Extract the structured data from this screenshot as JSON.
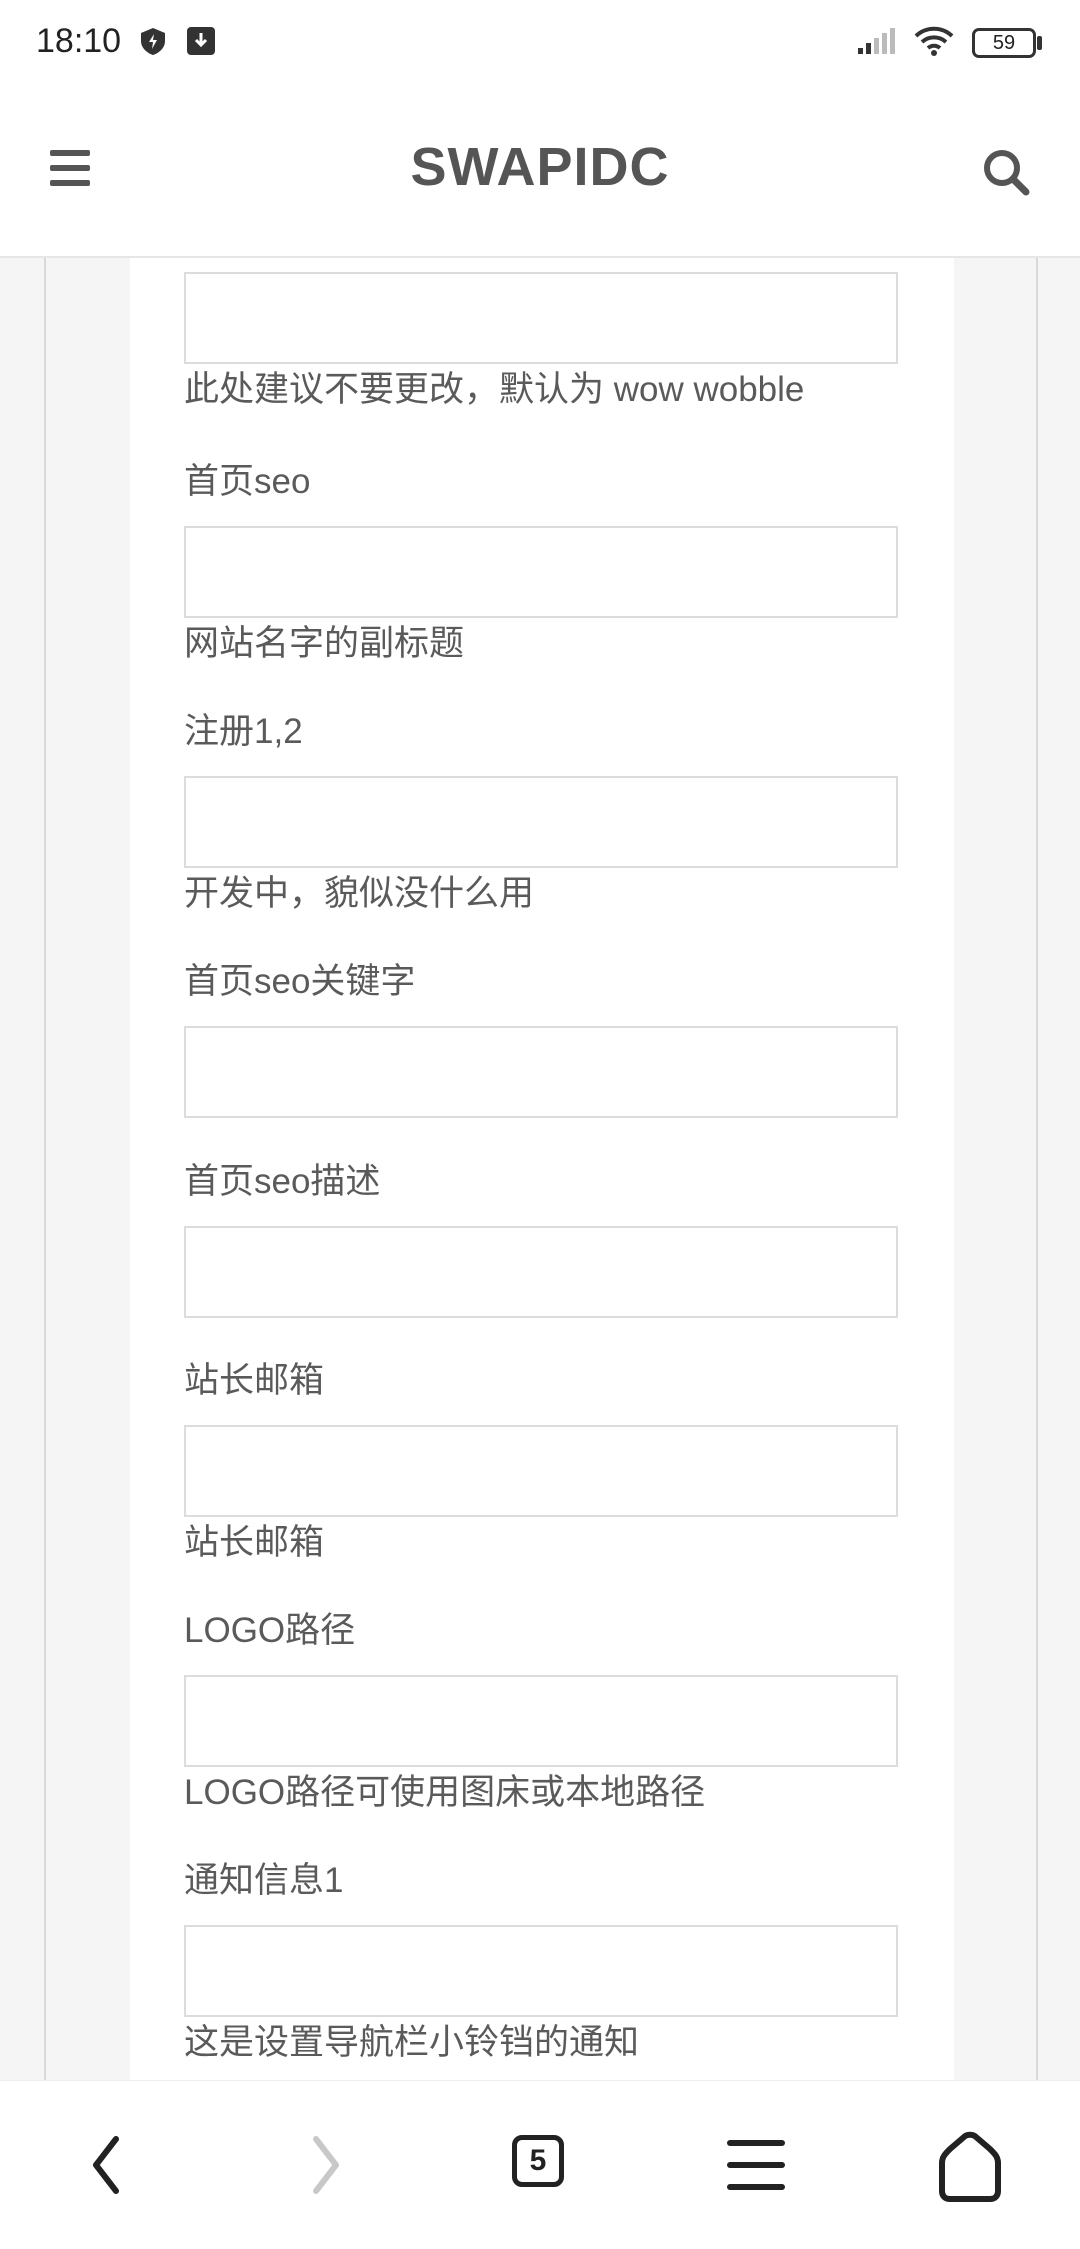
{
  "status_bar": {
    "time": "18:10",
    "battery": "59",
    "icons": [
      "shield-icon",
      "download-icon",
      "signal-icon",
      "wifi-icon",
      "battery-icon"
    ]
  },
  "header": {
    "title": "SWAPIDC",
    "menu_icon": "hamburger-icon",
    "search_icon": "search-icon"
  },
  "form": {
    "fields": [
      {
        "label": "",
        "value": "",
        "help": "此处建议不要更改，默认为 wow wobble"
      },
      {
        "label": "首页seo",
        "value": "",
        "help": "网站名字的副标题"
      },
      {
        "label": "注册1,2",
        "value": "",
        "help": "开发中，貌似没什么用"
      },
      {
        "label": "首页seo关键字",
        "value": "",
        "help": ""
      },
      {
        "label": "首页seo描述",
        "value": "",
        "help": ""
      },
      {
        "label": "站长邮箱",
        "value": "",
        "help": "站长邮箱"
      },
      {
        "label": "LOGO路径",
        "value": "",
        "help": "LOGO路径可使用图床或本地路径"
      },
      {
        "label": "通知信息1",
        "value": "",
        "help": "这是设置导航栏小铃铛的通知"
      }
    ]
  },
  "browser_nav": {
    "tab_count": "5",
    "icons": [
      "back-icon",
      "forward-icon",
      "tabs-icon",
      "menu-icon",
      "home-icon"
    ]
  },
  "colors": {
    "text": "#555555",
    "input_border": "#dcdcdc",
    "page_bg": "#f5f5f5"
  }
}
